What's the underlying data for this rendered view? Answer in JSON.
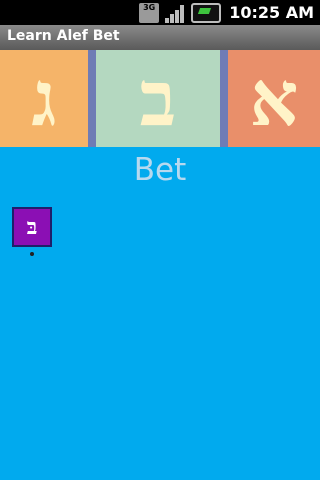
{
  "status_bar": {
    "network_label": "3G",
    "time": "10:25 AM",
    "icons": [
      "3g-icon",
      "signal-icon",
      "battery-icon"
    ]
  },
  "app": {
    "title": "Learn Alef Bet"
  },
  "banner": {
    "tiles": [
      {
        "letter": "ג",
        "color": "#f5b469"
      },
      {
        "letter": "ב",
        "color": "#b4d8c0"
      },
      {
        "letter": "א",
        "color": "#e98f6a"
      }
    ]
  },
  "main": {
    "letter_name": "Bet",
    "letter_glyph": "בּ",
    "background_color": "#01aaee"
  }
}
